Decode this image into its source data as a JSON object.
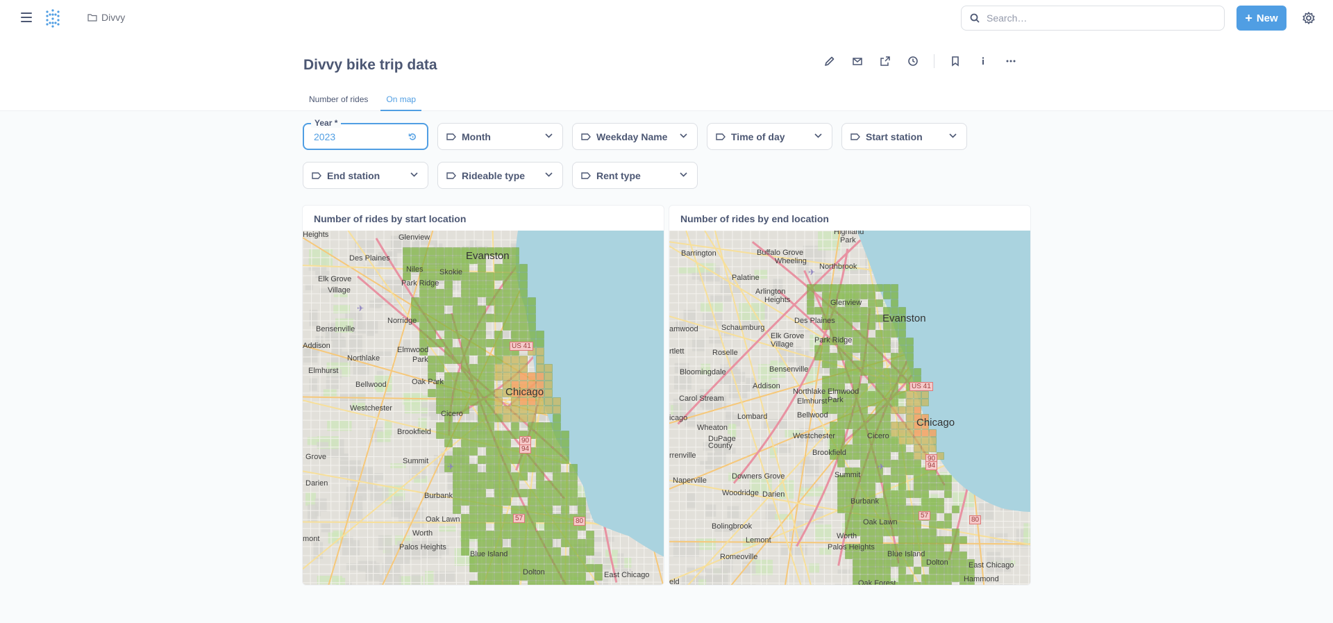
{
  "breadcrumb": {
    "collection": "Divvy"
  },
  "search": {
    "placeholder": "Search…"
  },
  "new_button": {
    "label": "New"
  },
  "dashboard": {
    "title": "Divvy bike trip data",
    "tabs": [
      {
        "label": "Number of rides",
        "active": false
      },
      {
        "label": "On map",
        "active": true
      }
    ]
  },
  "filters": {
    "year": {
      "label": "Year *",
      "value": "2023"
    },
    "month": "Month",
    "weekday": "Weekday Name",
    "time_of_day": "Time of day",
    "start_station": "Start station",
    "end_station": "End station",
    "rideable_type": "Rideable type",
    "rent_type": "Rent type"
  },
  "cards": [
    {
      "title": "Number of rides by start location",
      "labels": [
        "Heights",
        "Glenview",
        "Evanston",
        "Des Plaines",
        "Niles",
        "Skokie",
        "Elk Grove",
        "Park Ridge",
        "Village",
        "Norridge",
        "Bensenville",
        "Elmwood",
        "Addison",
        "Northlake",
        "Park",
        "Elmhurst",
        "Bellwood",
        "Oak Park",
        "Chicago",
        "Westchester",
        "Cicero",
        "Brookfield",
        "Grove",
        "Summit",
        "Darien",
        "Burbank",
        "Oak Lawn",
        "Worth",
        "Palos Heights",
        "Blue Island",
        "Dolton",
        "East Chicago",
        "mont"
      ],
      "highways": [
        "US 41",
        "90",
        "94",
        "57",
        "80"
      ]
    },
    {
      "title": "Number of rides by end location",
      "labels": [
        "Highland",
        "Park",
        "Barrington",
        "Buffalo Grove",
        "Wheeling",
        "Northbrook",
        "Palatine",
        "Arlington",
        "Heights",
        "Glenview",
        "Evanston",
        "Des Plaines",
        "Schaumburg",
        "amwood",
        "Elk Grove",
        "Village",
        "Park Ridge",
        "rtlett",
        "Roselle",
        "Bloomingdale",
        "Bensenville",
        "Addison",
        "Northlake",
        "Elmwood",
        "Park",
        "Chicago",
        "Carol Stream",
        "Elmhurst",
        "Bellwood",
        "icago",
        "Lombard",
        "Wheaton",
        "Westchester",
        "Cicero",
        "DuPage",
        "County",
        "rrenville",
        "Brookfield",
        "Summit",
        "Naperville",
        "Downers Grove",
        "Woodridge",
        "Darien",
        "Burbank",
        "Oak Lawn",
        "Bolingbrook",
        "Worth",
        "Lemont",
        "Palos Heights",
        "Blue Island",
        "Dolton",
        "East Chicago",
        "Romeoville",
        "Hammond",
        "Oak Forest",
        "eld"
      ],
      "highways": [
        "US 41",
        "90",
        "94",
        "57",
        "80"
      ]
    }
  ],
  "colors": {
    "accent": "#509ee3",
    "text": "#4c5773",
    "heat_low": "#7cb342",
    "heat_high": "#f4a261",
    "lake": "#aad3df"
  }
}
